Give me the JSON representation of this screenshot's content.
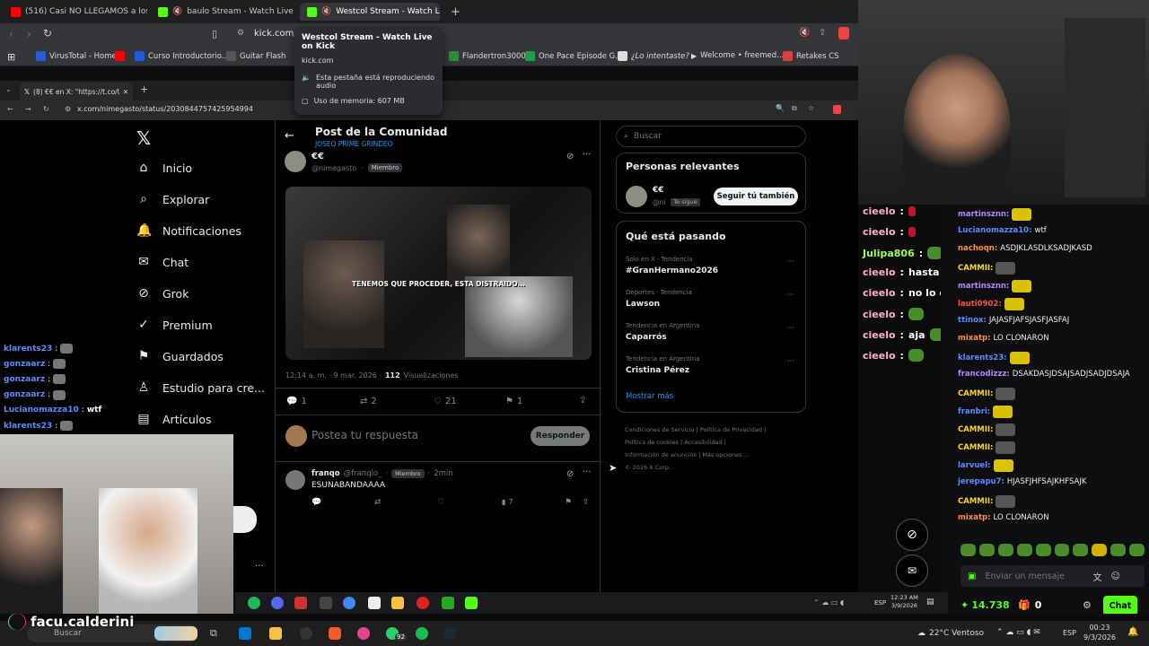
{
  "browser": {
    "tabs": [
      {
        "title": "(516) Casi NO LLEGAMOS a los SHO",
        "favicon_color": "#ff0000",
        "muted": false
      },
      {
        "title": "baulo Stream - Watch Live o",
        "favicon_color": "#53fc18",
        "muted": true
      },
      {
        "title": "Westcol Stream - Watch Live",
        "favicon_color": "#53fc18",
        "muted": true
      }
    ],
    "url": "kick.com/b",
    "bookmarks": [
      "VirusTotal - Home",
      "Curso Introductorio...",
      "Guitar Flash",
      "Flandertron3000",
      "One Pace Episode G...",
      "¿Lo intentaste?",
      "Welcome • freemed...",
      "Retakes CS"
    ],
    "tooltip": {
      "title": "Westcol Stream - Watch Live on Kick",
      "domain": "kick.com",
      "audio": "Esta pestaña está reproduciendo audio",
      "memory": "Uso de memoria: 607 MB"
    }
  },
  "inner_browser": {
    "tab_title": "(8) €€ en X: \"https://t.co/U",
    "url": "x.com/nimegasto/status/2030844757425954994"
  },
  "x": {
    "nav": [
      {
        "label": "Inicio",
        "icon": "home-icon"
      },
      {
        "label": "Explorar",
        "icon": "search-icon"
      },
      {
        "label": "Notificaciones",
        "icon": "bell-icon"
      },
      {
        "label": "Chat",
        "icon": "chat-icon"
      },
      {
        "label": "Grok",
        "icon": "grok-icon"
      },
      {
        "label": "Premium",
        "icon": "premium-icon"
      },
      {
        "label": "Guardados",
        "icon": "bookmark-icon"
      },
      {
        "label": "Estudio para cre...",
        "icon": "studio-icon"
      },
      {
        "label": "Artículos",
        "icon": "articles-icon"
      }
    ],
    "header": {
      "title": "Post de la Comunidad",
      "subtitle": "JOSEO PRIME GRINDEO"
    },
    "post": {
      "name": "€€",
      "handle": "@nimegasto",
      "badge": "Miembro",
      "video_caption": "TENEMOS QUE PROCEDER, ESTA DISTRAIDO...",
      "timestamp": "12:14 a. m. · 9 mar. 2026 ·",
      "views_count": "112",
      "views_label": "Visualizaciones",
      "replies": "1",
      "reposts": "2",
      "likes": "21",
      "bookmarks": "1"
    },
    "reply_box": {
      "placeholder": "Postea tu respuesta",
      "button": "Responder"
    },
    "reply": {
      "name": "franqo",
      "handle": "@franqlo_",
      "badge": "Miembro",
      "time": "2min",
      "text": "ESUNABANDAAAA",
      "views": "7"
    },
    "search_placeholder": "Buscar",
    "relevant": {
      "title": "Personas relevantes",
      "name": "€€",
      "handle": "@ni",
      "follows_you": "Te sigue",
      "follow_button": "Seguir tú también"
    },
    "trends": {
      "title": "Qué está pasando",
      "items": [
        {
          "context": "Solo en X · Tendencia",
          "name": "#GranHermano2026"
        },
        {
          "context": "Deportes · Tendencia",
          "name": "Lawson"
        },
        {
          "context": "Tendencia en Argentina",
          "name": "Caparrós"
        },
        {
          "context": "Tendencia en Argentina",
          "name": "Cristina Pérez"
        }
      ],
      "more": "Mostrar más"
    },
    "footer": [
      "Condiciones de Servicio",
      "Política de Privacidad",
      "Política de cookies",
      "Accesibilidad",
      "Información de anuncios",
      "Más opciones ...",
      "© 2026 X Corp."
    ]
  },
  "left_chat": [
    {
      "user": "klarents23",
      "color": "#5b8cff"
    },
    {
      "user": "gonzaarz",
      "color": "#5b8cff"
    },
    {
      "user": "gonzaarz",
      "color": "#5b8cff"
    },
    {
      "user": "gonzaarz",
      "color": "#5b8cff"
    },
    {
      "user": "Lucianomazza10",
      "color": "#5b8cff",
      "text": "wtf"
    },
    {
      "user": "klarents23",
      "color": "#5b8cff"
    }
  ],
  "overlay_chat": [
    {
      "user": "cieelo",
      "text": ""
    },
    {
      "user": "cieelo",
      "text": ""
    },
    {
      "user": "Julipa806",
      "text": ""
    },
    {
      "user": "cieelo",
      "text": "hasta aca llegaste calderas"
    },
    {
      "user": "cieelo",
      "text": "no lo conozco a ese"
    },
    {
      "user": "cieelo",
      "text": ""
    },
    {
      "user": "cieelo",
      "text": "aja"
    },
    {
      "user": "cieelo",
      "text": ""
    }
  ],
  "kick_chat": {
    "messages": [
      {
        "user": "martinsznn:",
        "text": "",
        "color": "#b388ff"
      },
      {
        "user": "Lucianomazza10:",
        "text": "wtf",
        "color": "#5b8cff"
      },
      {
        "user": "nachoqn:",
        "text": "ASDJKLASDLKSADJKASD",
        "color": "#ff8f3f"
      },
      {
        "user": "CAMMII:",
        "text": "",
        "color": "#ffd700"
      },
      {
        "user": "martinsznn:",
        "text": "",
        "color": "#b388ff"
      },
      {
        "user": "lauti0902:",
        "text": "",
        "color": "#ff4d4d"
      },
      {
        "user": "ttinox:",
        "text": "JAJASFJAFSJASFJASFAJ",
        "color": "#5b8cff"
      },
      {
        "user": "mixatp:",
        "text": "LO CLONARON",
        "color": "#ff8f3f"
      },
      {
        "user": "klarents23:",
        "text": "",
        "color": "#5b8cff"
      },
      {
        "user": "francodizzz:",
        "text": "DSAKDASJDSAJSADJSADJDSAJA",
        "color": "#b388ff"
      },
      {
        "user": "CAMMII:",
        "text": "",
        "color": "#ffd700"
      },
      {
        "user": "franbri:",
        "text": "",
        "color": "#5b8cff"
      },
      {
        "user": "CAMMII:",
        "text": "",
        "color": "#ffd700"
      },
      {
        "user": "CAMMII:",
        "text": "",
        "color": "#ffd700"
      },
      {
        "user": "larvuel:",
        "text": "",
        "color": "#5b8cff"
      },
      {
        "user": "jerepapu7:",
        "text": "HJASFJHFSAJKHFSAJK",
        "color": "#5b8cff"
      },
      {
        "user": "CAMMII:",
        "text": "",
        "color": "#ffd700"
      },
      {
        "user": "mixatp:",
        "text": "LO CLONARON",
        "color": "#ff8f3f"
      }
    ],
    "input_placeholder": "Enviar un mensaje",
    "viewers": "14.738",
    "gifts": "0",
    "chat_button": "Chat"
  },
  "taskbar_inner": {
    "time": "12:23 AM",
    "date": "3/9/2026",
    "lang": "ESP"
  },
  "taskbar_outer": {
    "search": "Buscar",
    "weather": "22°C  Ventoso",
    "lang": "ESP",
    "time": "00:23",
    "date": "9/3/2026",
    "whatsapp_badge": "92"
  },
  "tiktok": {
    "handle": "facu.calderini"
  }
}
